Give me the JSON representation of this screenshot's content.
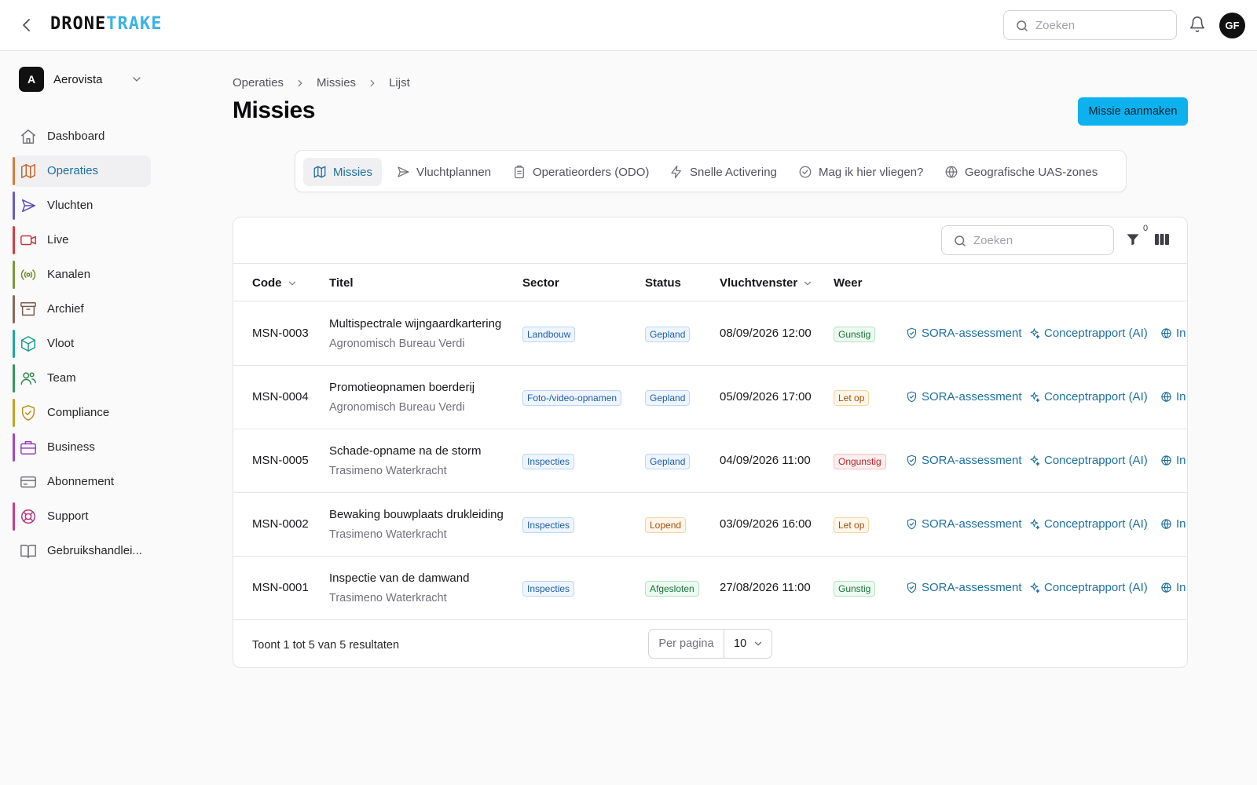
{
  "header": {
    "logo_part1": "DRONE",
    "logo_part2": "TRAKE",
    "search_placeholder": "Zoeken",
    "avatar_initials": "GF"
  },
  "org": {
    "badge": "A",
    "name": "Aerovista"
  },
  "sidebar": {
    "items": [
      {
        "label": "Dashboard",
        "icon": "home-icon",
        "color": "#71717a",
        "bar": ""
      },
      {
        "label": "Operaties",
        "icon": "map-icon",
        "color": "#c2622a",
        "bar": "#d77a3f",
        "active": true
      },
      {
        "label": "Vluchten",
        "icon": "send-icon",
        "color": "#5b4bb8",
        "bar": "#6a5acd"
      },
      {
        "label": "Live",
        "icon": "video-icon",
        "color": "#c8323c",
        "bar": "#d93b45"
      },
      {
        "label": "Kanalen",
        "icon": "radio-icon",
        "color": "#6a8a2a",
        "bar": "#7a9a35"
      },
      {
        "label": "Archief",
        "icon": "archive-icon",
        "color": "#7a5a4a",
        "bar": "#8a6a5a"
      },
      {
        "label": "Vloot",
        "icon": "box-icon",
        "color": "#199a8a",
        "bar": "#20a898"
      },
      {
        "label": "Team",
        "icon": "users-icon",
        "color": "#2a8a4a",
        "bar": "#33995a"
      },
      {
        "label": "Compliance",
        "icon": "shield-icon",
        "color": "#b8901a",
        "bar": "#c9a020"
      },
      {
        "label": "Business",
        "icon": "briefcase-icon",
        "color": "#9a3ab8",
        "bar": "#a845c5"
      },
      {
        "label": "Abonnement",
        "icon": "credit-card-icon",
        "color": "#71717a",
        "bar": ""
      },
      {
        "label": "Support",
        "icon": "life-buoy-icon",
        "color": "#b8327a",
        "bar": "#c53d88"
      },
      {
        "label": "Gebruikshandlei...",
        "icon": "book-icon",
        "color": "#71717a",
        "bar": ""
      }
    ]
  },
  "breadcrumb": [
    "Operaties",
    "Missies",
    "Lijst"
  ],
  "page": {
    "title": "Missies",
    "create_button": "Missie aanmaken"
  },
  "tabs": [
    {
      "label": "Missies",
      "icon": "map-icon",
      "active": true
    },
    {
      "label": "Vluchtplannen",
      "icon": "send-icon"
    },
    {
      "label": "Operatieorders (ODO)",
      "icon": "clipboard-icon"
    },
    {
      "label": "Snelle Activering",
      "icon": "zap-icon"
    },
    {
      "label": "Mag ik hier vliegen?",
      "icon": "check-circle-icon"
    },
    {
      "label": "Geografische UAS-zones",
      "icon": "globe-icon"
    }
  ],
  "table": {
    "search_placeholder": "Zoeken",
    "filter_count": "0",
    "columns": [
      "Code",
      "Titel",
      "Sector",
      "Status",
      "Vluchtvenster",
      "Weer"
    ],
    "actions": [
      "SORA-assessment",
      "Conceptrapport (AI)",
      "In p"
    ],
    "rows": [
      {
        "code": "MSN-0003",
        "title": "Multispectrale wijngaardkartering",
        "client": "Agronomisch Bureau Verdi",
        "sector": "Landbouw",
        "status": "Gepland",
        "status_type": "blue",
        "window": "08/09/2026 12:00",
        "weather": "Gunstig",
        "weather_type": "green"
      },
      {
        "code": "MSN-0004",
        "title": "Promotieopnamen boerderij",
        "client": "Agronomisch Bureau Verdi",
        "sector": "Foto-/video-opnamen",
        "status": "Gepland",
        "status_type": "blue",
        "window": "05/09/2026 17:00",
        "weather": "Let op",
        "weather_type": "orange"
      },
      {
        "code": "MSN-0005",
        "title": "Schade-opname na de storm",
        "client": "Trasimeno Waterkracht",
        "sector": "Inspecties",
        "status": "Gepland",
        "status_type": "blue",
        "window": "04/09/2026 11:00",
        "weather": "Ongunstig",
        "weather_type": "red"
      },
      {
        "code": "MSN-0002",
        "title": "Bewaking bouwplaats drukleiding",
        "client": "Trasimeno Waterkracht",
        "sector": "Inspecties",
        "status": "Lopend",
        "status_type": "orange",
        "window": "03/09/2026 16:00",
        "weather": "Let op",
        "weather_type": "orange"
      },
      {
        "code": "MSN-0001",
        "title": "Inspectie van de damwand",
        "client": "Trasimeno Waterkracht",
        "sector": "Inspecties",
        "status": "Afgesloten",
        "status_type": "green",
        "window": "27/08/2026 11:00",
        "weather": "Gunstig",
        "weather_type": "green"
      }
    ],
    "footer_text": "Toont 1 tot 5 van 5 resultaten",
    "per_page_label": "Per pagina",
    "per_page_value": "10"
  }
}
